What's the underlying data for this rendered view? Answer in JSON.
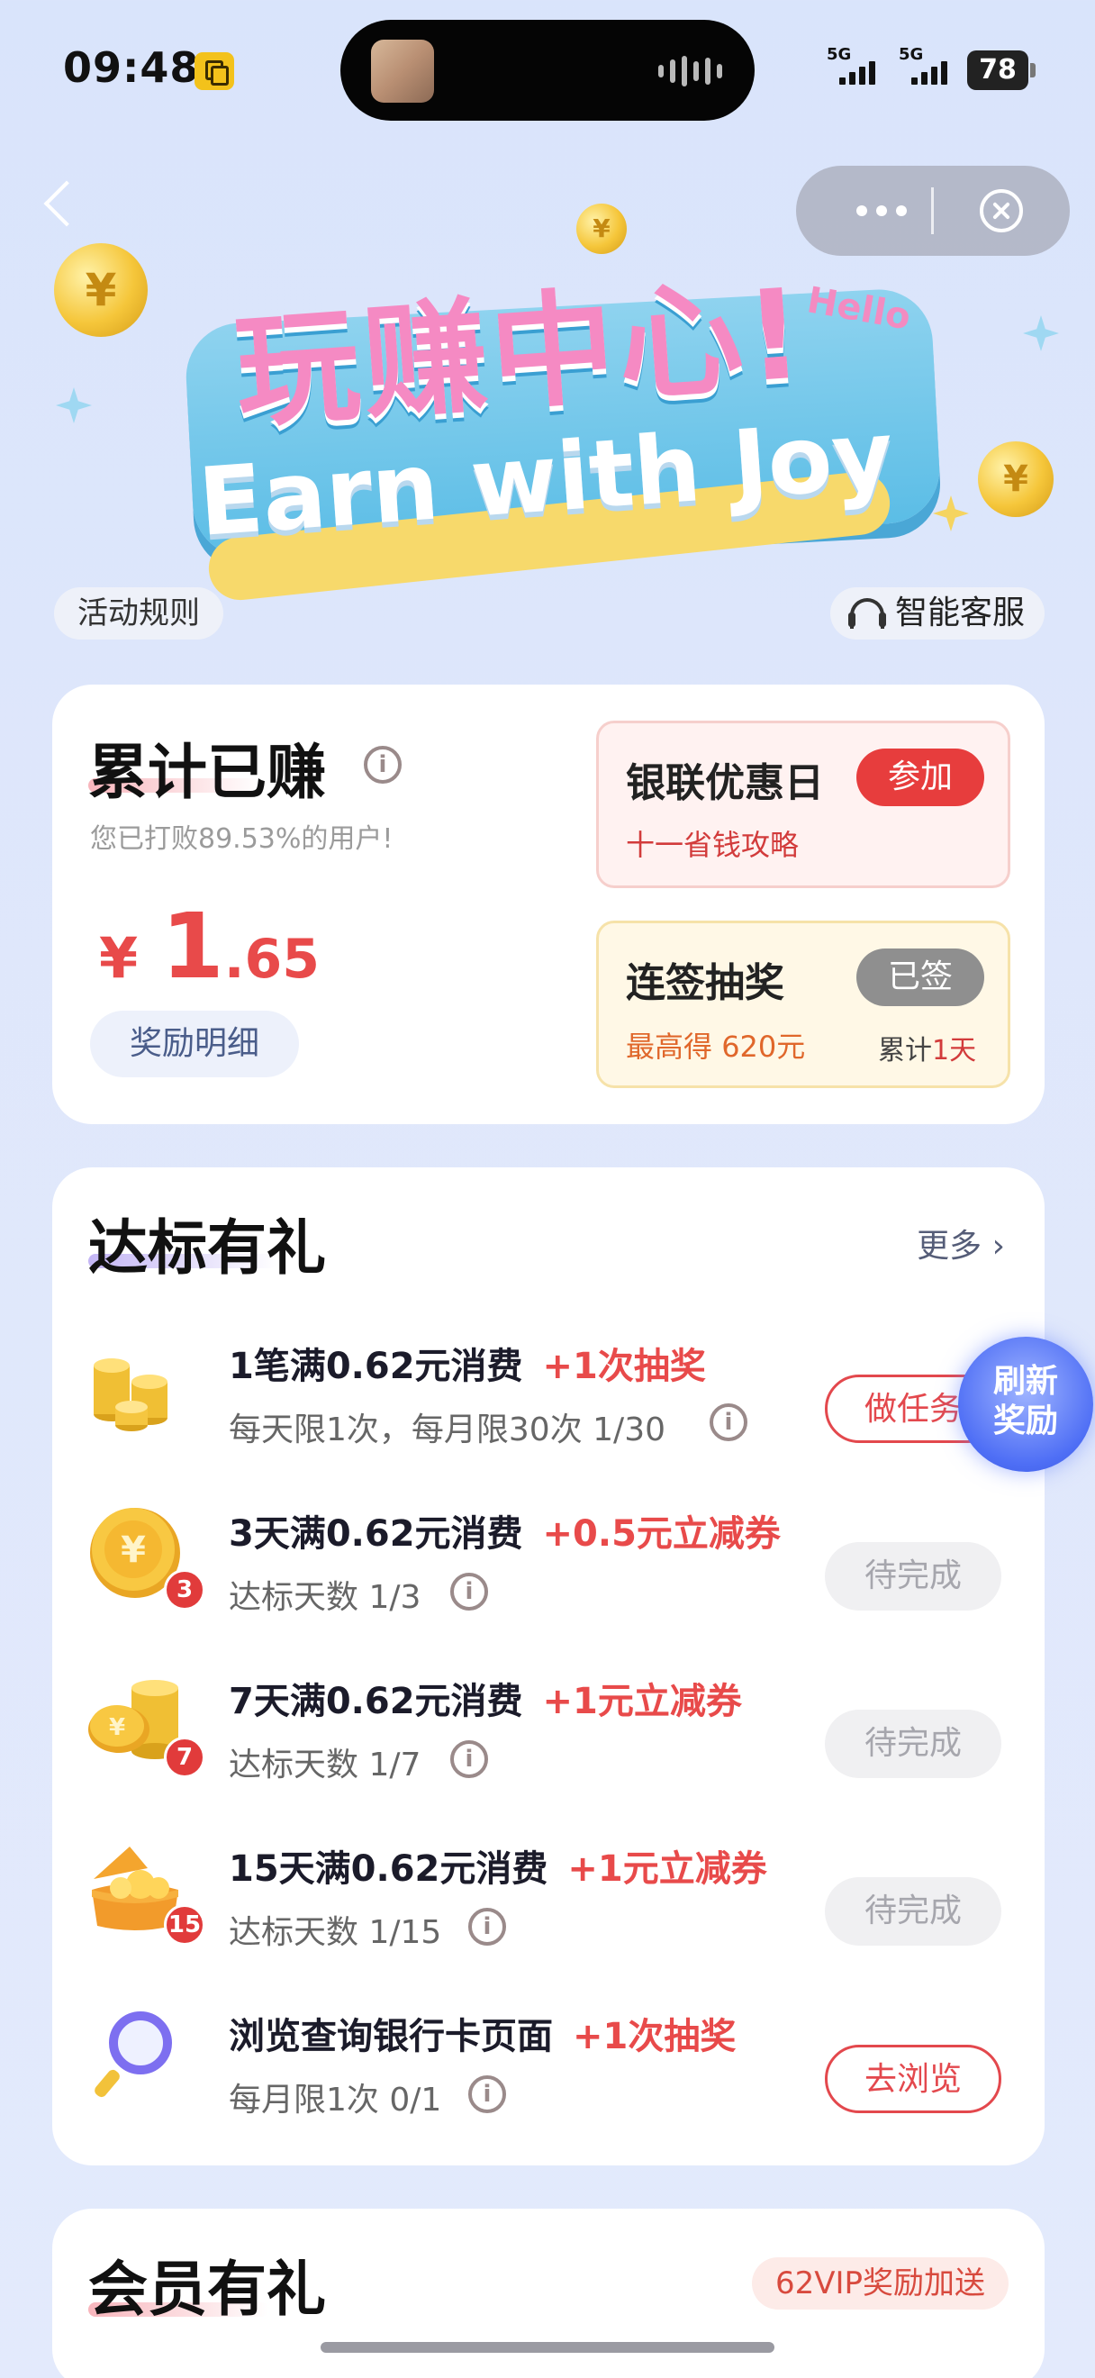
{
  "status_bar": {
    "time": "09:48",
    "net1": "5G",
    "net2": "5G",
    "battery": "78"
  },
  "hero": {
    "banner_zh": "玩赚中心!",
    "banner_en": "Earn with Joy",
    "banner_hello": "Hello",
    "rules_label": "活动规则",
    "service_label": "智能客服"
  },
  "earnings": {
    "title": "累计已赚",
    "subtitle": "您已打败89.53%的用户!",
    "currency": "¥",
    "amount_int": "1",
    "amount_dec": ".65",
    "detail_button": "奖励明细"
  },
  "unionpay": {
    "title": "银联优惠日",
    "subtitle": "十一省钱攻略",
    "button": "参加"
  },
  "signin": {
    "title": "连签抽奖",
    "max_prefix": "最高得",
    "max_value": "620元",
    "button": "已签",
    "count_prefix": "累计",
    "count_value": "1天"
  },
  "tasks": {
    "title": "达标有礼",
    "more": "更多 ›",
    "refresh": [
      "刷新",
      "奖励"
    ],
    "items": [
      {
        "title": "1笔满0.62元消费",
        "bonus": "+1次抽奖",
        "sub": "每天限1次，每月限30次  1/30",
        "button": "做任务",
        "icon": "coin-stack-icon"
      },
      {
        "title": "3天满0.62元消费",
        "bonus": "+0.5元立减券",
        "sub": "达标天数  1/3",
        "button": "待完成",
        "badge": "3",
        "icon": "yuan-coin-icon"
      },
      {
        "title": "7天满0.62元消费",
        "bonus": "+1元立减券",
        "sub": "达标天数  1/7",
        "button": "待完成",
        "badge": "7",
        "icon": "coin-pile-icon"
      },
      {
        "title": "15天满0.62元消费",
        "bonus": "+1元立减券",
        "sub": "达标天数  1/15",
        "button": "待完成",
        "badge": "15",
        "icon": "treasure-chest-icon"
      },
      {
        "title": "浏览查询银行卡页面",
        "bonus": "+1次抽奖",
        "sub": "每月限1次  0/1",
        "button": "去浏览",
        "icon": "magnifier-icon"
      }
    ]
  },
  "member": {
    "title": "会员有礼",
    "tag": "62VIP奖励加送"
  },
  "colors": {
    "accent_red": "#e84a4a",
    "gray_button": "#f0f0f2",
    "refresh_blue": "#4e6ef5"
  }
}
